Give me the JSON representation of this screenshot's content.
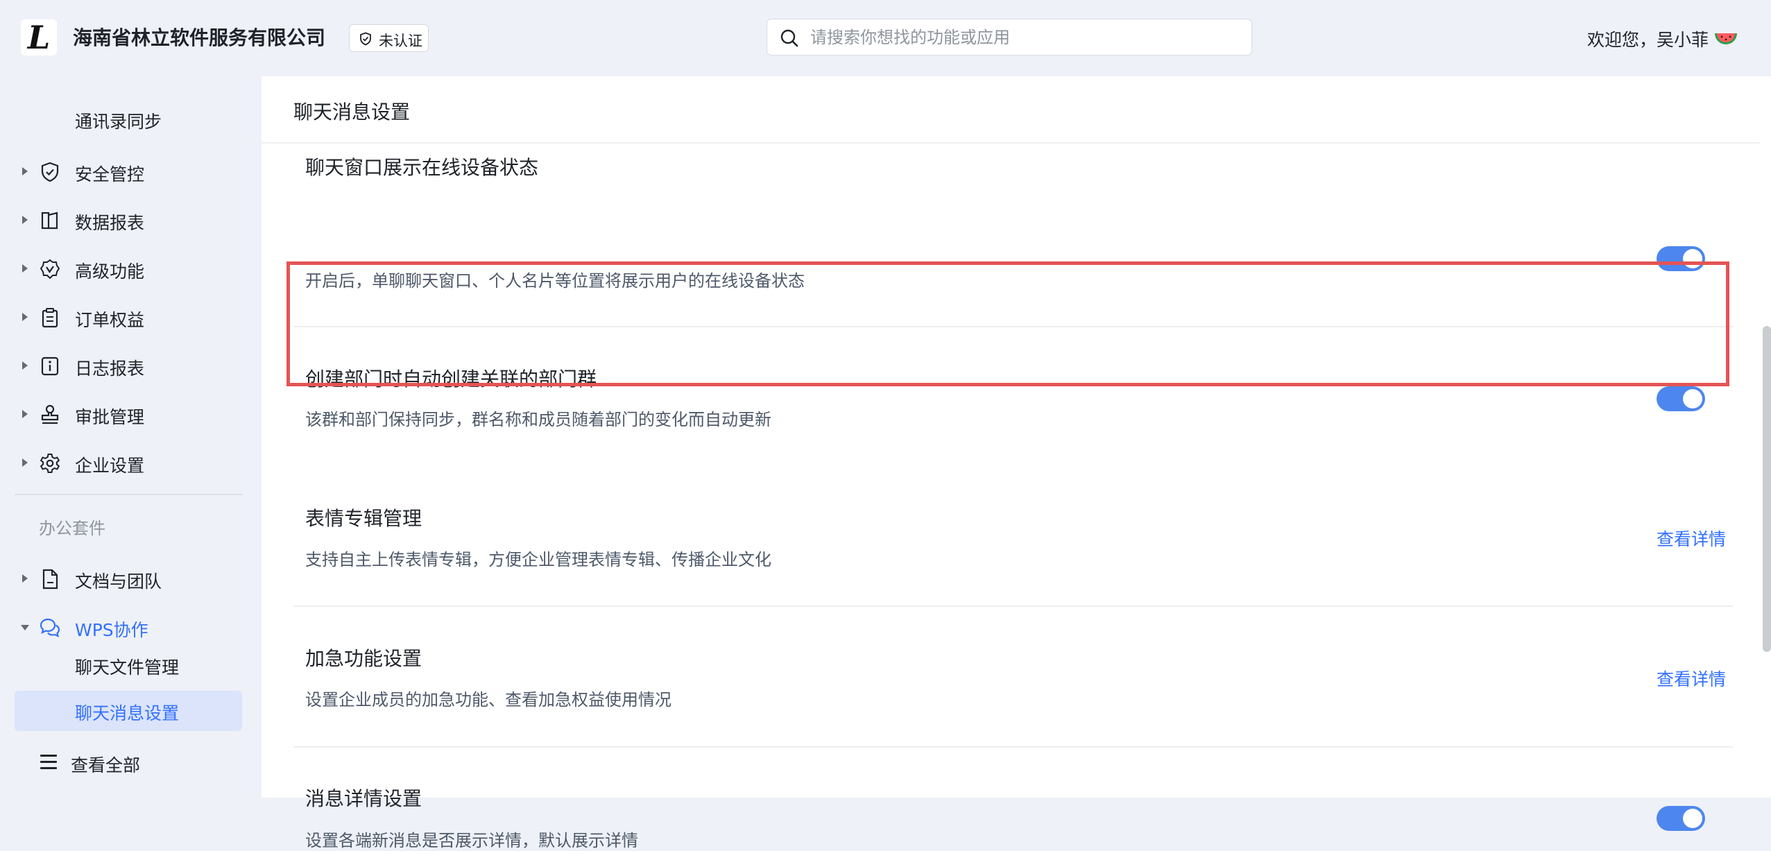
{
  "header": {
    "logo_glyph": "L",
    "company_name": "海南省林立软件服务有限公司",
    "verify_badge": "未认证",
    "search_placeholder": "请搜索你想找的功能或应用",
    "welcome_text": "欢迎您，吴小菲"
  },
  "sidebar": {
    "items_top": [
      {
        "label": "通讯录同步",
        "icon": "none",
        "level": "sub"
      },
      {
        "label": "安全管控",
        "icon": "shield-check-icon"
      },
      {
        "label": "数据报表",
        "icon": "book-icon"
      },
      {
        "label": "高级功能",
        "icon": "badge-check-icon"
      },
      {
        "label": "订单权益",
        "icon": "clipboard-icon"
      },
      {
        "label": "日志报表",
        "icon": "info-icon"
      },
      {
        "label": "审批管理",
        "icon": "stamp-icon"
      },
      {
        "label": "企业设置",
        "icon": "gear-icon"
      }
    ],
    "group_label": "办公套件",
    "items_office": [
      {
        "label": "文档与团队",
        "icon": "document-icon",
        "expanded": false
      },
      {
        "label": "WPS协作",
        "icon": "chat-bubbles-icon",
        "expanded": true
      }
    ],
    "wps_children": [
      {
        "label": "聊天文件管理",
        "active": false
      },
      {
        "label": "聊天消息设置",
        "active": true
      }
    ],
    "view_all": "查看全部",
    "active_color": "#3370ff"
  },
  "main": {
    "title": "聊天消息设置",
    "settings": [
      {
        "title": "聊天窗口展示在线设备状态",
        "desc": "开启后，单聊聊天窗口、个人名片等位置将展示用户的在线设备状态",
        "control": "toggle",
        "enabled": true
      },
      {
        "title": "创建部门时自动创建关联的部门群",
        "desc": "该群和部门保持同步，群名称和成员随着部门的变化而自动更新",
        "control": "toggle",
        "enabled": true,
        "highlighted": true
      },
      {
        "title": "表情专辑管理",
        "desc": "支持自主上传表情专辑，方便企业管理表情专辑、传播企业文化",
        "control": "link",
        "link_label": "查看详情"
      },
      {
        "title": "加急功能设置",
        "desc": "设置企业成员的加急功能、查看加急权益使用情况",
        "control": "link",
        "link_label": "查看详情"
      },
      {
        "title": "消息详情设置",
        "desc": "设置各端新消息是否展示详情，默认展示详情",
        "control": "toggle",
        "enabled": true
      }
    ]
  },
  "colors": {
    "accent": "#3370ff",
    "toggle_on": "#4d86ee",
    "highlight_border": "#e55454",
    "sidebar_bg": "#eef1f7"
  }
}
